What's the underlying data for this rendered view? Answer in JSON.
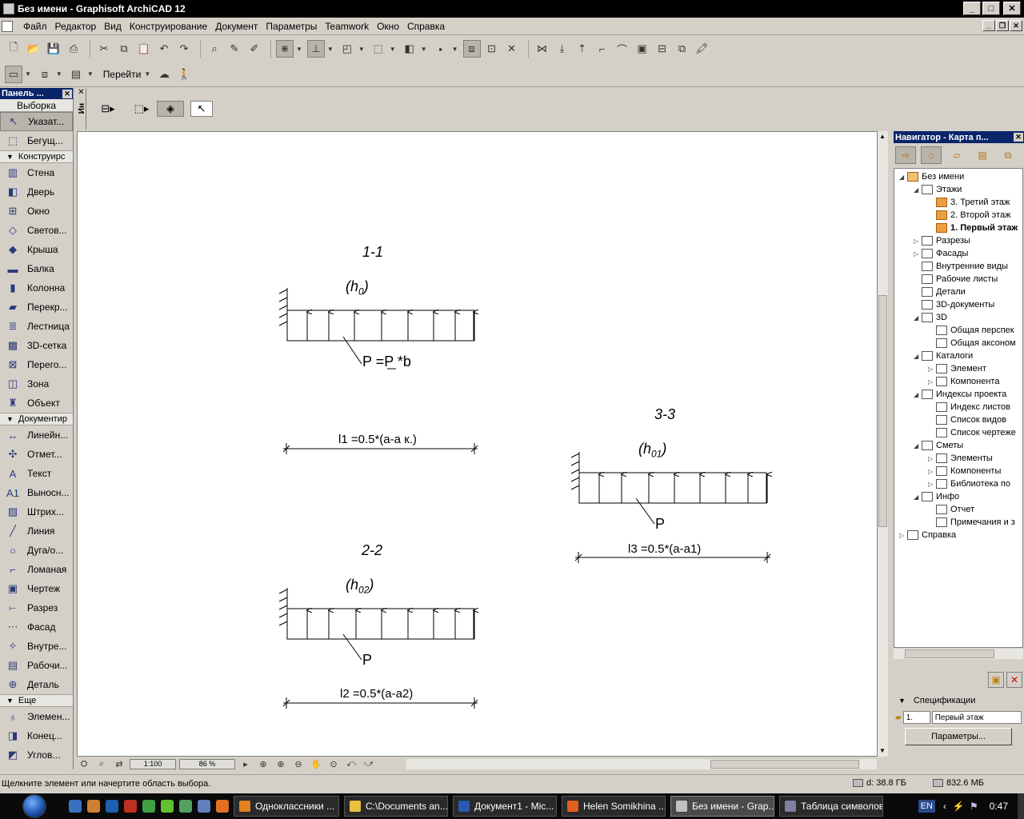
{
  "window": {
    "title": "Без имени - Graphisoft ArchiCAD 12",
    "min": "_",
    "max": "□",
    "close": "✕"
  },
  "menu": [
    "Файл",
    "Редактор",
    "Вид",
    "Конструирование",
    "Документ",
    "Параметры",
    "Teamwork",
    "Окно",
    "Справка"
  ],
  "toolbar": {
    "goto_label": "Перейти"
  },
  "toolbox": {
    "title": "Панель ...",
    "header": "Выборка",
    "select_items": [
      {
        "icon": "arrow-icon",
        "glyph": "↖",
        "label": "Указат..."
      },
      {
        "icon": "marquee-icon",
        "glyph": "⬚",
        "label": "Бегущ..."
      }
    ],
    "construct_section": "Конструирс",
    "construct_items": [
      {
        "icon": "wall-icon",
        "glyph": "▥",
        "label": "Стена"
      },
      {
        "icon": "door-icon",
        "glyph": "◧",
        "label": "Дверь"
      },
      {
        "icon": "window-icon",
        "glyph": "⊞",
        "label": "Окно"
      },
      {
        "icon": "skylight-icon",
        "glyph": "◇",
        "label": "Светов..."
      },
      {
        "icon": "roof-icon",
        "glyph": "◆",
        "label": "Крыша"
      },
      {
        "icon": "beam-icon",
        "glyph": "▬",
        "label": "Балка"
      },
      {
        "icon": "column-icon",
        "glyph": "▮",
        "label": "Колонна"
      },
      {
        "icon": "slab-icon",
        "glyph": "▰",
        "label": "Перекр..."
      },
      {
        "icon": "stair-icon",
        "glyph": "≣",
        "label": "Лестница"
      },
      {
        "icon": "mesh-icon",
        "glyph": "▩",
        "label": "3D-сетка"
      },
      {
        "icon": "curtainwall-icon",
        "glyph": "⊠",
        "label": "Перего..."
      },
      {
        "icon": "zone-icon",
        "glyph": "◫",
        "label": "Зона"
      },
      {
        "icon": "object-icon",
        "glyph": "♜",
        "label": "Объект"
      }
    ],
    "document_section": "Документир",
    "document_items": [
      {
        "icon": "dimension-icon",
        "glyph": "↔",
        "label": "Линейн..."
      },
      {
        "icon": "level-dimension-icon",
        "glyph": "✣",
        "label": "Отмет..."
      },
      {
        "icon": "text-icon",
        "glyph": "A",
        "label": "Текст"
      },
      {
        "icon": "label-icon",
        "glyph": "A1",
        "label": "Выносн..."
      },
      {
        "icon": "fill-icon",
        "glyph": "▨",
        "label": "Штрих..."
      },
      {
        "icon": "line-icon",
        "glyph": "╱",
        "label": "Линия"
      },
      {
        "icon": "arc-icon",
        "glyph": "○",
        "label": "Дуга/о..."
      },
      {
        "icon": "polyline-icon",
        "glyph": "⌐",
        "label": "Ломаная"
      },
      {
        "icon": "drawing-icon",
        "glyph": "▣",
        "label": "Чертеж"
      },
      {
        "icon": "section-icon",
        "glyph": "⤚",
        "label": "Разрез"
      },
      {
        "icon": "elevation-icon",
        "glyph": "⋯",
        "label": "Фасад"
      },
      {
        "icon": "interior-elevation-icon",
        "glyph": "✧",
        "label": "Внутре..."
      },
      {
        "icon": "worksheet-icon",
        "glyph": "▤",
        "label": "Рабочи..."
      },
      {
        "icon": "detail-icon",
        "glyph": "⊕",
        "label": "Деталь"
      }
    ],
    "more_section": "Еще",
    "more_items": [
      {
        "icon": "lamp-icon",
        "glyph": "♁",
        "label": "Элемен..."
      },
      {
        "icon": "wall-end-icon",
        "glyph": "◨",
        "label": "Конец..."
      },
      {
        "icon": "corner-window-icon",
        "glyph": "◩",
        "label": "Углов..."
      }
    ]
  },
  "infobox": {
    "tab_label": "Ин"
  },
  "drawing": {
    "sections": [
      {
        "title": "1-1",
        "h_base": "(h",
        "h_sub": "0",
        "h_close": ")",
        "p_label": "P =P *b",
        "dim": "l1 =0.5*(a-a к.)"
      },
      {
        "title": "2-2",
        "h_base": "(h",
        "h_sub": "02",
        "h_close": ")",
        "p_label": "P",
        "dim": "l2 =0.5*(a-a2)"
      },
      {
        "title": "3-3",
        "h_base": "(h",
        "h_sub": "01",
        "h_close": ")",
        "p_label": "P",
        "dim": "l3 =0.5*(a-a1)"
      }
    ]
  },
  "canvas_footer": {
    "scale": "1:100",
    "zoom": "86 %"
  },
  "navigator": {
    "title": "Навигатор - Карта п...",
    "tree": [
      {
        "label": "Без имени",
        "icon": "project-icon",
        "level": 0,
        "exp": "◢"
      },
      {
        "label": "Этажи",
        "icon": "stories-icon",
        "level": 1,
        "exp": "◢"
      },
      {
        "label": "3. Третий этаж",
        "icon": "story-icon",
        "level": 2,
        "exp": ""
      },
      {
        "label": "2. Второй этаж",
        "icon": "story-icon",
        "level": 2,
        "exp": ""
      },
      {
        "label": "1. Первый этаж",
        "icon": "story-icon",
        "level": 2,
        "exp": "",
        "bold": true
      },
      {
        "label": "Разрезы",
        "icon": "sections-icon",
        "level": 1,
        "exp": "▷"
      },
      {
        "label": "Фасады",
        "icon": "elevations-icon",
        "level": 1,
        "exp": "▷"
      },
      {
        "label": "Внутренние виды",
        "icon": "interior-views-icon",
        "level": 1,
        "exp": ""
      },
      {
        "label": "Рабочие листы",
        "icon": "worksheets-icon",
        "level": 1,
        "exp": ""
      },
      {
        "label": "Детали",
        "icon": "details-icon",
        "level": 1,
        "exp": ""
      },
      {
        "label": "3D-документы",
        "icon": "3d-documents-icon",
        "level": 1,
        "exp": ""
      },
      {
        "label": "3D",
        "icon": "3d-icon",
        "level": 1,
        "exp": "◢"
      },
      {
        "label": "Общая перспек",
        "icon": "perspective-icon",
        "level": 2,
        "exp": ""
      },
      {
        "label": "Общая аксоном",
        "icon": "axonometry-icon",
        "level": 2,
        "exp": ""
      },
      {
        "label": "Каталоги",
        "icon": "schedules-icon",
        "level": 1,
        "exp": "◢"
      },
      {
        "label": "Элемент",
        "icon": "element-schedule-icon",
        "level": 2,
        "exp": "▷"
      },
      {
        "label": "Компонента",
        "icon": "component-schedule-icon",
        "level": 2,
        "exp": "▷"
      },
      {
        "label": "Индексы проекта",
        "icon": "project-indexes-icon",
        "level": 1,
        "exp": "◢"
      },
      {
        "label": "Индекс листов",
        "icon": "sheet-index-icon",
        "level": 2,
        "exp": ""
      },
      {
        "label": "Список видов",
        "icon": "view-list-icon",
        "level": 2,
        "exp": ""
      },
      {
        "label": "Список чертеже",
        "icon": "drawing-list-icon",
        "level": 2,
        "exp": ""
      },
      {
        "label": "Сметы",
        "icon": "lists-icon",
        "level": 1,
        "exp": "◢"
      },
      {
        "label": "Элементы",
        "icon": "elements-list-icon",
        "level": 2,
        "exp": "▷"
      },
      {
        "label": "Компоненты",
        "icon": "components-list-icon",
        "level": 2,
        "exp": "▷"
      },
      {
        "label": "Библиотека по",
        "icon": "library-icon",
        "level": 2,
        "exp": "▷"
      },
      {
        "label": "Инфо",
        "icon": "info-icon",
        "level": 1,
        "exp": "◢"
      },
      {
        "label": "Отчет",
        "icon": "report-icon",
        "level": 2,
        "exp": ""
      },
      {
        "label": "Примечания и з",
        "icon": "notes-icon",
        "level": 2,
        "exp": ""
      },
      {
        "label": "Справка",
        "icon": "help-icon",
        "level": 0,
        "exp": "▷"
      }
    ],
    "specs_label": "Спецификации",
    "story_num": "1.",
    "story_name": "Первый этаж",
    "params_button": "Параметры..."
  },
  "status": {
    "hint": "Щелкните элемент или начертите область выбора.",
    "disk": "d: 38.8 ГБ",
    "memory": "832.6 МБ"
  },
  "taskbar": {
    "tasks": [
      {
        "label": "Одноклассники ...",
        "color": "#e08020"
      },
      {
        "label": "C:\\Documents an...",
        "color": "#e8c040"
      },
      {
        "label": "Документ1 - Mic...",
        "color": "#2a5ab0"
      },
      {
        "label": "Helen Somikhina ...",
        "color": "#e06020"
      },
      {
        "label": "Без имени - Grap...",
        "color": "#c0c0c0",
        "active": true
      },
      {
        "label": "Таблица символов",
        "color": "#8080a0"
      }
    ],
    "lang": "EN",
    "time": "0:47"
  }
}
